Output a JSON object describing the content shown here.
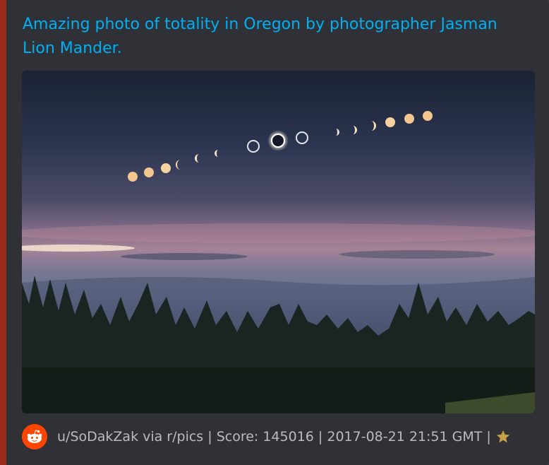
{
  "embed": {
    "title": "Amazing photo of totality in Oregon by photographer Jasman Lion Mander.",
    "accent_color": "#9c2a1c",
    "title_color": "#00b0f4"
  },
  "image": {
    "subject": "eclipse sequence over forested Oregon hills at dusk"
  },
  "footer": {
    "icon": "reddit-icon",
    "text": "u/SoDakZak via r/pics | Score: 145016 | 2017-08-21 21:51 GMT |",
    "star_icon": "star-icon",
    "star_color": "#c8a04a"
  }
}
